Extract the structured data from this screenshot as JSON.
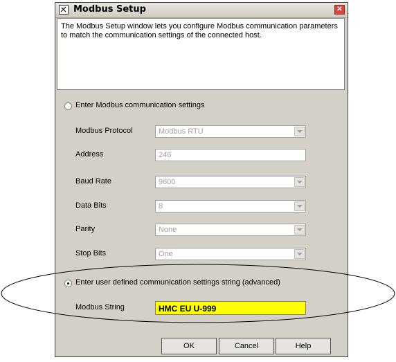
{
  "window": {
    "title": "Modbus Setup",
    "close_symbol": "✕"
  },
  "description": "The Modbus Setup window lets you configure Modbus communication parameters to match the communication settings of the connected host.",
  "option_standard": {
    "label": "Enter Modbus communication settings",
    "selected": false
  },
  "fields": {
    "protocol": {
      "label": "Modbus Protocol",
      "value": "Modbus RTU"
    },
    "address": {
      "label": "Address",
      "value": "246"
    },
    "baud_rate": {
      "label": "Baud Rate",
      "value": "9600"
    },
    "data_bits": {
      "label": "Data Bits",
      "value": "8"
    },
    "parity": {
      "label": "Parity",
      "value": "None"
    },
    "stop_bits": {
      "label": "Stop Bits",
      "value": "One"
    }
  },
  "option_advanced": {
    "label": "Enter user defined communication settings string (advanced)",
    "selected": true
  },
  "modbus_string": {
    "label": "Modbus String",
    "value": "HMC EU U-999",
    "highlight_color": "#ffff00"
  },
  "buttons": {
    "ok": "OK",
    "cancel": "Cancel",
    "help": "Help"
  }
}
